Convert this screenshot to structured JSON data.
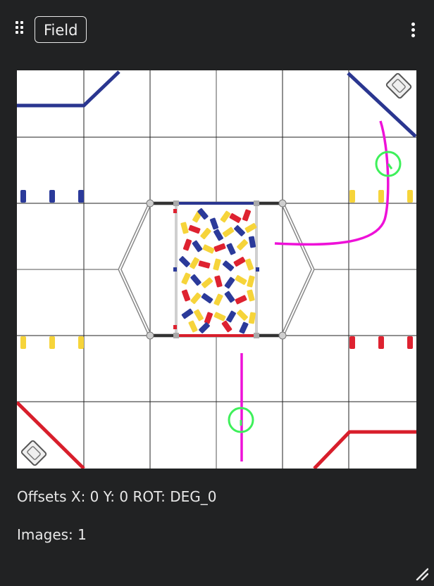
{
  "widget": {
    "title": "Field"
  },
  "info": {
    "offsets": "Offsets X: 0 Y: 0 ROT: DEG_0",
    "images": "Images: 1"
  },
  "colors": {
    "panel_bg": "#212223",
    "field_bg": "#ffffff",
    "grid_line": "#000000",
    "blue_alliance": "#2a3690",
    "red_alliance": "#d81e2b",
    "sample_yellow": "#f6d43a",
    "sample_blue": "#2b3a9a",
    "sample_red": "#de2230",
    "robot_path": "#ee11d8",
    "robot_marker": "#3ef05a"
  },
  "icons": {
    "drag_handle": "drag-handle-icon",
    "menu": "more-vertical-icon",
    "resize": "resize-grip-icon"
  }
}
